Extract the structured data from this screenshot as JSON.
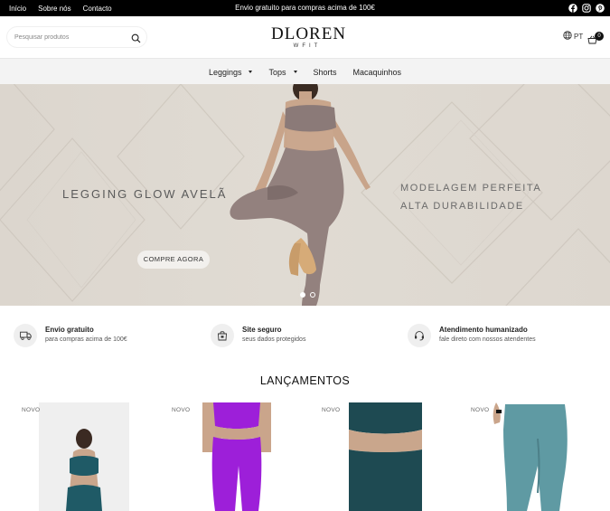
{
  "topbar": {
    "links": [
      "Início",
      "Sobre nós",
      "Contacto"
    ],
    "announcement": "Envio gratuito para compras acima de 100€",
    "social_icons": [
      "facebook-icon",
      "instagram-icon",
      "pinterest-icon"
    ]
  },
  "header": {
    "search_placeholder": "Pesquisar produtos",
    "logo_main": "DLOREN",
    "logo_sub": "WFIT",
    "language": "PT",
    "cart_count": "0"
  },
  "nav": {
    "items": [
      {
        "label": "Leggings",
        "has_dropdown": true
      },
      {
        "label": "Tops",
        "has_dropdown": true
      },
      {
        "label": "Shorts",
        "has_dropdown": false
      },
      {
        "label": "Macaquinhos",
        "has_dropdown": false
      }
    ]
  },
  "hero": {
    "title": "LEGGING GLOW AVELÃ",
    "subtitle_line1": "MODELAGEM PERFEITA",
    "subtitle_line2": "ALTA DURABILIDADE",
    "button_label": "COMPRE AGORA",
    "slides": 2,
    "active_slide": 1
  },
  "features": [
    {
      "title": "Envio gratuito",
      "subtitle": "para compras acima de 100€",
      "icon": "truck-icon"
    },
    {
      "title": "Site seguro",
      "subtitle": "seus dados protegidos",
      "icon": "lock-bag-icon"
    },
    {
      "title": "Atendimento humanizado",
      "subtitle": "fale direto com nossos atendentes",
      "icon": "headset-icon"
    }
  ],
  "section": {
    "title": "LANÇAMENTOS"
  },
  "products": [
    {
      "badge": "NOVO",
      "color": "#1f5a66"
    },
    {
      "badge": "NOVO",
      "color": "#9d1fd9"
    },
    {
      "badge": "NOVO",
      "color": "#1e4a52"
    },
    {
      "badge": "NOVO",
      "color": "#5f9aa3"
    }
  ],
  "colors": {
    "topbar_bg": "#000000",
    "nav_bg": "#f3f3f3",
    "hero_bg": "#dcd6ce"
  }
}
